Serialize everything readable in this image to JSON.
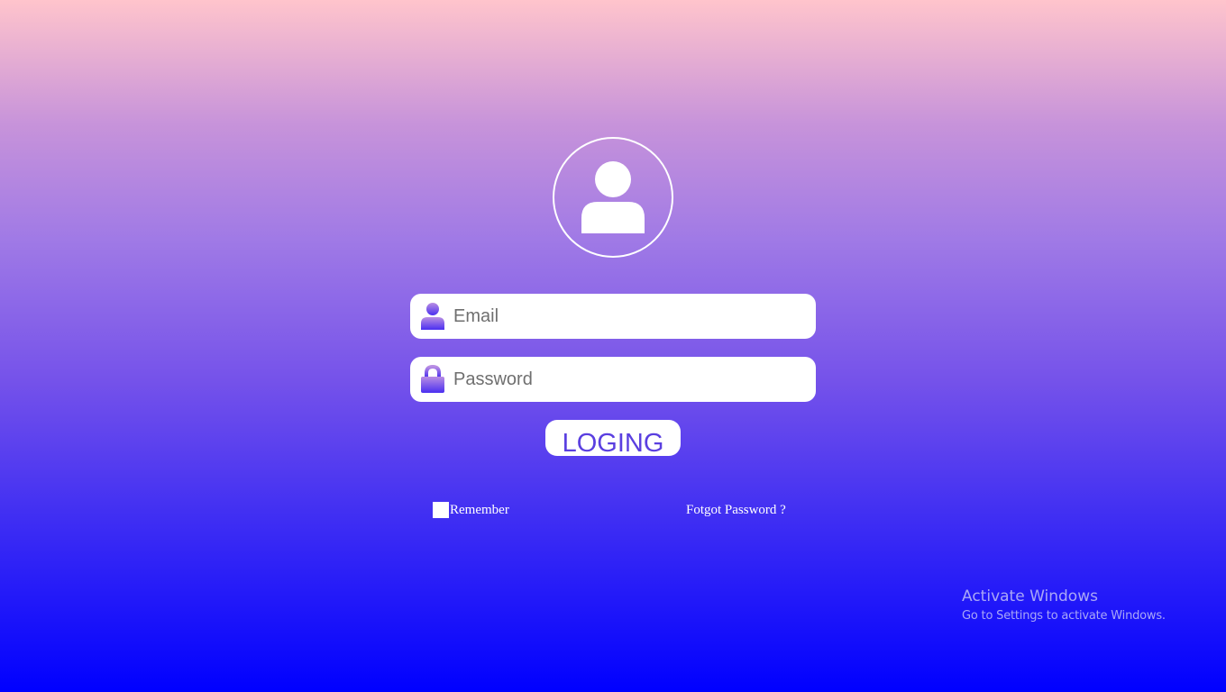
{
  "login_form": {
    "avatar_icon": "user-avatar-icon",
    "email": {
      "icon": "user-icon",
      "placeholder": "Email",
      "value": ""
    },
    "password": {
      "icon": "lock-icon",
      "placeholder": "Password",
      "value": ""
    },
    "login_label": "LOGING",
    "remember_label": "Remember",
    "remember_checked": false,
    "forgot_label": "Fotgot Password ?"
  },
  "watermark": {
    "title": "Activate Windows",
    "subtitle": "Go to Settings to activate Windows."
  },
  "colors": {
    "gradient_top": "#ffc4cc",
    "gradient_bottom": "#0000ff",
    "button_text": "#5a3fe0",
    "icon_gradient_top": "#b98ee3",
    "icon_gradient_bottom": "#4a2ff0"
  }
}
